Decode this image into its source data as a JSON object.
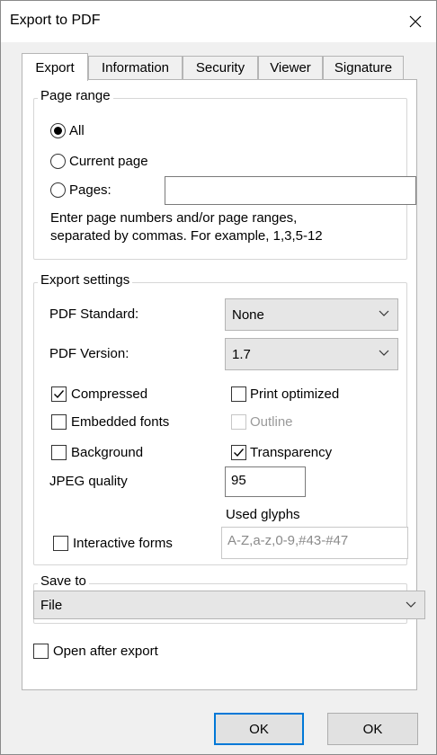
{
  "window": {
    "title": "Export to PDF"
  },
  "tabs": [
    "Export",
    "Information",
    "Security",
    "Viewer",
    "Signature"
  ],
  "page_range": {
    "legend": "Page range",
    "all_label": "All",
    "current_page_label": "Current page",
    "pages_label": "Pages:",
    "pages_value": "",
    "hint_line1": "Enter page numbers and/or page ranges,",
    "hint_line2": "separated by commas. For example, 1,3,5-12",
    "selected": "All"
  },
  "export_settings": {
    "legend": "Export settings",
    "pdf_standard_label": "PDF Standard:",
    "pdf_standard_value": "None",
    "pdf_version_label": "PDF Version:",
    "pdf_version_value": "1.7",
    "compressed_label": "Compressed",
    "compressed_checked": true,
    "print_optimized_label": "Print optimized",
    "print_optimized_checked": false,
    "embedded_fonts_label": "Embedded fonts",
    "embedded_fonts_checked": false,
    "outline_label": "Outline",
    "outline_checked": false,
    "background_label": "Background",
    "background_checked": false,
    "transparency_label": "Transparency",
    "transparency_checked": true,
    "jpeg_quality_label": "JPEG quality",
    "jpeg_quality_value": "95",
    "used_glyphs_label": "Used glyphs",
    "used_glyphs_value": "A-Z,a-z,0-9,#43-#47",
    "interactive_forms_label": "Interactive forms",
    "interactive_forms_checked": false
  },
  "save_to": {
    "legend": "Save to",
    "value": "File"
  },
  "open_after_export": {
    "label": "Open after export",
    "checked": false
  },
  "buttons": {
    "ok_label": "OK",
    "second_label": "OK"
  },
  "colors": {
    "focus_border": "#0078d7",
    "window_bg": "#f0f0f0"
  }
}
